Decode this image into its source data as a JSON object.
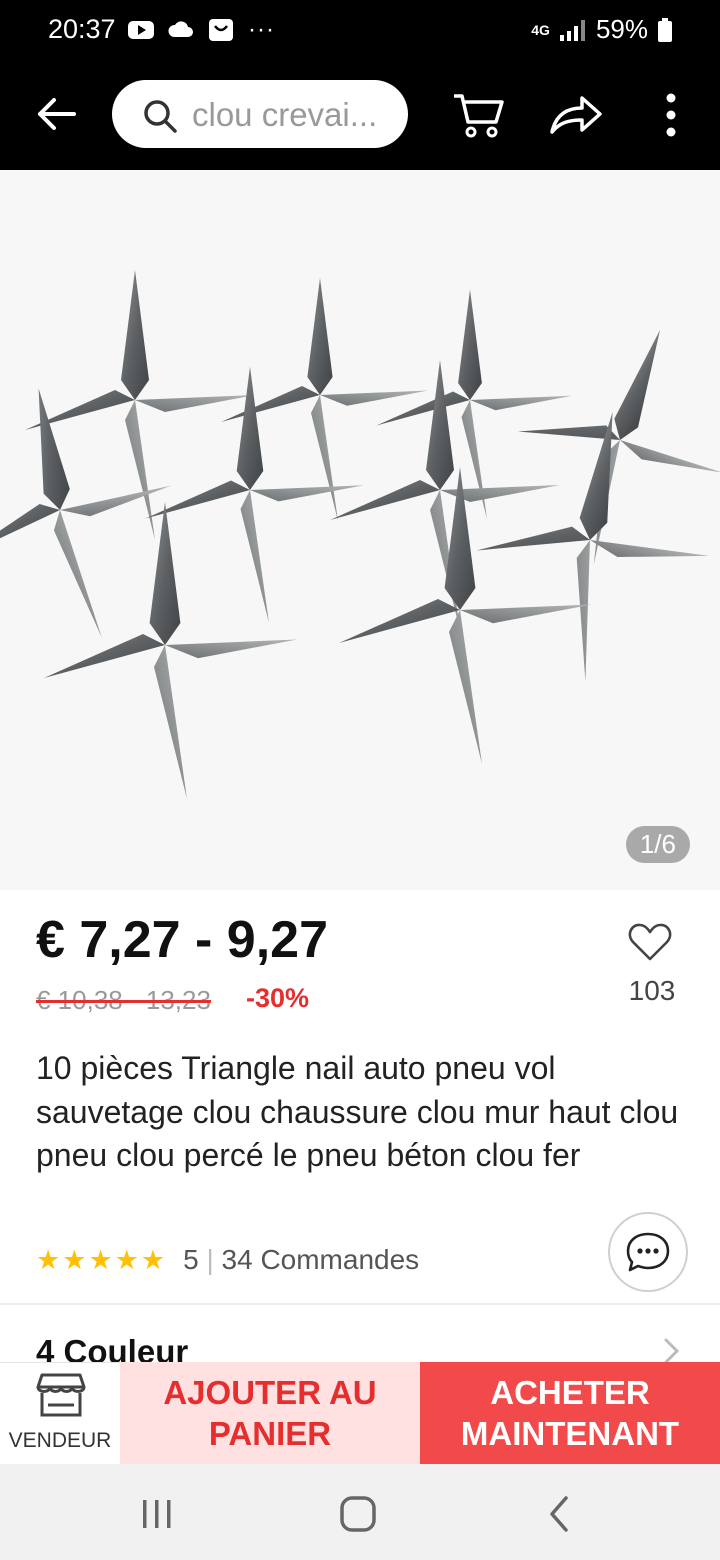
{
  "status_bar": {
    "time": "20:37",
    "network": "4G",
    "battery": "59%",
    "more": "···"
  },
  "header": {
    "search_text": "clou crevai..."
  },
  "gallery": {
    "counter": "1/6"
  },
  "product": {
    "price": "€ 7,27 - 9,27",
    "old_price": "€ 10,38 - 13,23",
    "discount": "-30%",
    "wishlist_count": "103",
    "title": "10 pièces Triangle nail auto pneu vol sauvetage clou chaussure clou mur haut clou pneu clou percé le pneu béton clou fer",
    "rating": "5",
    "separator": "|",
    "orders": "34 Commandes",
    "variant_section": "4 Couleur"
  },
  "actions": {
    "vendor": "VENDEUR",
    "add_to_cart": "AJOUTER AU PANIER",
    "buy_now": "ACHETER MAINTENANT"
  },
  "colors": {
    "accent_red": "#e62e2e",
    "buy_bg": "#f24a4a",
    "cart_bg": "#ffe1e1",
    "star": "#ffc107"
  },
  "icons": [
    "back-arrow-icon",
    "search-icon",
    "cart-icon",
    "share-icon",
    "more-vertical-icon",
    "heart-icon",
    "chat-icon",
    "chevron-right-icon",
    "store-icon",
    "recents-icon",
    "home-icon",
    "back-icon"
  ]
}
